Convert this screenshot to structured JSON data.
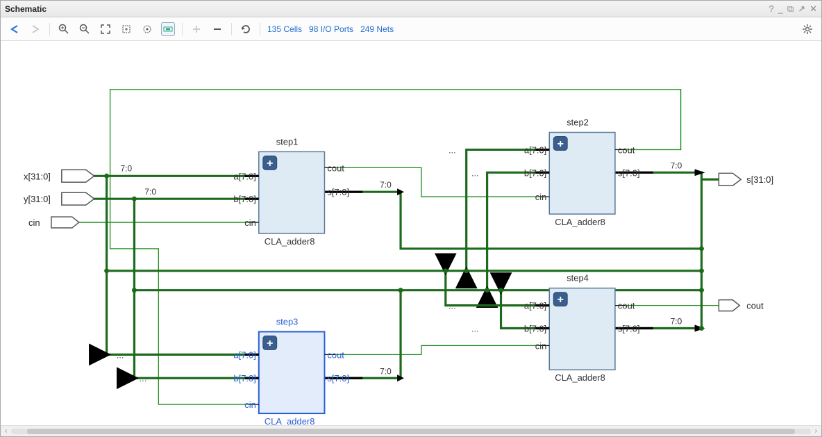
{
  "title": "Schematic",
  "window_controls": {
    "help": "?",
    "minimize": "_",
    "restore": "⧉",
    "popout": "↗",
    "close": "✕"
  },
  "toolbar": {
    "cells": "135 Cells",
    "ioports": "98 I/O Ports",
    "nets": "249 Nets"
  },
  "external_ports": {
    "x": {
      "label": "x[31:0]"
    },
    "y": {
      "label": "y[31:0]"
    },
    "cin": {
      "label": "cin"
    },
    "s": {
      "label": "s[31:0]"
    },
    "cout": {
      "label": "cout"
    }
  },
  "slice_labels": {
    "x": "7:0",
    "y": "7:0",
    "s1": "7:0",
    "s2": "7:0",
    "s3": "7:0",
    "s4": "7:0"
  },
  "blocks": {
    "step1": {
      "inst": "step1",
      "type": "CLA_adder8",
      "selected": false,
      "ports_left": [
        "a[7:0]",
        "b[7:0]",
        "cin"
      ],
      "ports_right": [
        "cout",
        "s[7:0]"
      ]
    },
    "step2": {
      "inst": "step2",
      "type": "CLA_adder8",
      "selected": false,
      "ports_left": [
        "a[7:0]",
        "b[7:0]",
        "cin"
      ],
      "ports_right": [
        "cout",
        "s[7:0]"
      ]
    },
    "step3": {
      "inst": "step3",
      "type": "CLA_adder8",
      "selected": true,
      "ports_left": [
        "a[7:0]",
        "b[7:0]",
        "cin"
      ],
      "ports_right": [
        "cout",
        "s[7:0]"
      ]
    },
    "step4": {
      "inst": "step4",
      "type": "CLA_adder8",
      "selected": false,
      "ports_left": [
        "a[7:0]",
        "b[7:0]",
        "cin"
      ],
      "ports_right": [
        "cout",
        "s[7:0]"
      ]
    }
  },
  "ellipsis": "..."
}
